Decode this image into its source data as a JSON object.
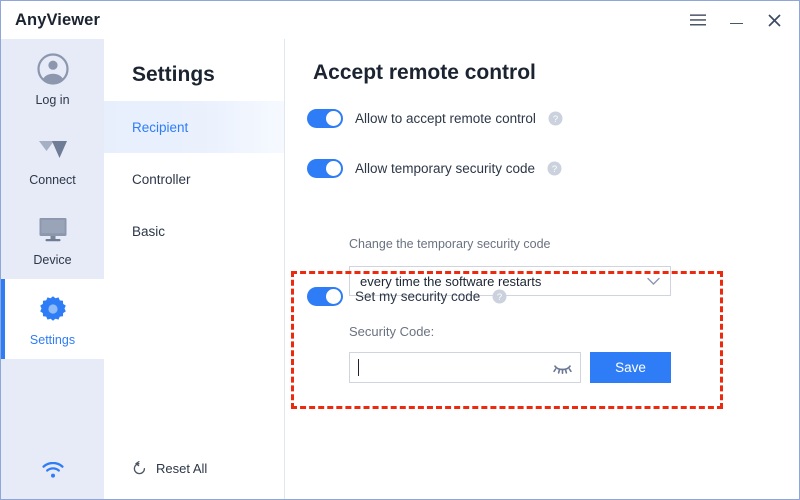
{
  "window": {
    "app_name": "AnyViewer",
    "controls": {
      "menu_label": "Menu",
      "minimize_label": "Minimize",
      "close_label": "Close"
    }
  },
  "rail": {
    "items": [
      {
        "id": "login",
        "label": "Log in",
        "icon": "user-circle-icon",
        "active": false
      },
      {
        "id": "connect",
        "label": "Connect",
        "icon": "connect-icon",
        "active": false
      },
      {
        "id": "device",
        "label": "Device",
        "icon": "monitor-icon",
        "active": false
      },
      {
        "id": "settings",
        "label": "Settings",
        "icon": "gear-icon",
        "active": true
      }
    ],
    "status_icon": "wifi-icon"
  },
  "nav": {
    "title": "Settings",
    "items": [
      {
        "id": "recipient",
        "label": "Recipient",
        "active": true
      },
      {
        "id": "controller",
        "label": "Controller",
        "active": false
      },
      {
        "id": "basic",
        "label": "Basic",
        "active": false
      }
    ],
    "reset_all_label": "Reset All",
    "reset_icon": "reset-arrow-icon"
  },
  "main": {
    "title": "Accept remote control",
    "toggles": [
      {
        "id": "allow-accept-remote-control",
        "label": "Allow to accept remote control",
        "on": true,
        "help": "help-icon"
      },
      {
        "id": "allow-temporary-security-code",
        "label": "Allow temporary security code",
        "on": true,
        "help": "help-icon"
      },
      {
        "id": "set-my-security-code",
        "label": "Set my security code",
        "on": true,
        "help": "help-icon"
      }
    ],
    "temp_code": {
      "label": "Change the temporary security code",
      "selected_option": "every time the software restarts",
      "options": [
        "every time the software restarts"
      ]
    },
    "security_code": {
      "label": "Security Code:",
      "value": "",
      "placeholder": "",
      "visibility_icon": "eye-off-icon",
      "save_label": "Save"
    }
  },
  "colors": {
    "accent": "#2f7df6",
    "rail_bg": "#e6ebf7",
    "highlight_border": "#ec2a0f",
    "text": "#2d3748",
    "muted_text": "#6b7280"
  }
}
